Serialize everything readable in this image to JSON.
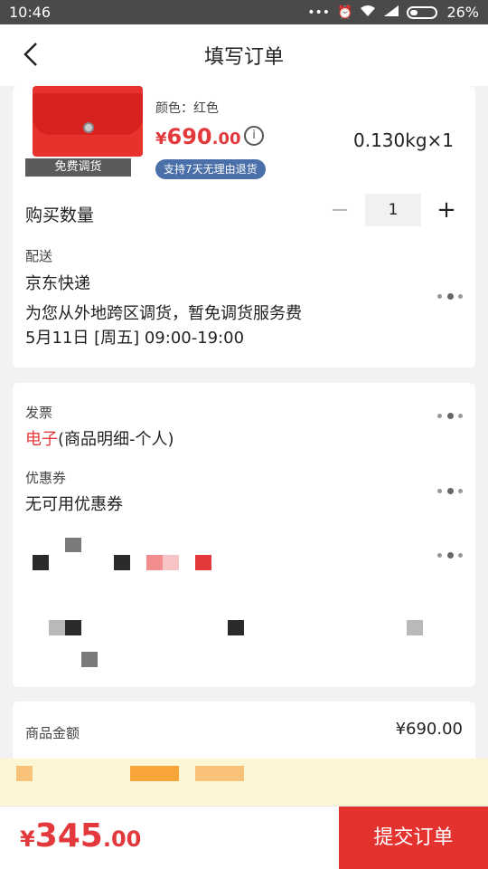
{
  "status_bar": {
    "time": "10:46",
    "battery": "26%"
  },
  "header": {
    "title": "填写订单"
  },
  "product": {
    "transfer_tag": "免费调货",
    "color": "颜色：红色",
    "price_yen": "¥",
    "price_main": "690",
    "price_cents": ".00",
    "info_symbol": "i",
    "weight": "0.130kg×1",
    "return_badge": "支持7天无理由退货"
  },
  "quantity": {
    "label": "购买数量",
    "minus": "−",
    "value": "1",
    "plus": "+"
  },
  "delivery": {
    "label": "配送",
    "carrier": "京东快递",
    "note": "为您从外地跨区调货，暂免调货服务费",
    "time": "5月11日 [周五] 09:00-19:00"
  },
  "invoice": {
    "label": "发票",
    "type": "电子",
    "detail": "(商品明细-个人)"
  },
  "coupon": {
    "label": "优惠券",
    "value": "无可用优惠券"
  },
  "summary": {
    "goods_amount_label": "商品金额",
    "goods_amount_value": "¥690.00"
  },
  "bottom": {
    "total_yen": "¥",
    "total_main": "345",
    "total_cents": ".00",
    "submit": "提交订单"
  },
  "colors": {
    "accent": "#e4393c",
    "submit_bg": "#e4322f",
    "badge_blue": "#4a6fa9"
  }
}
